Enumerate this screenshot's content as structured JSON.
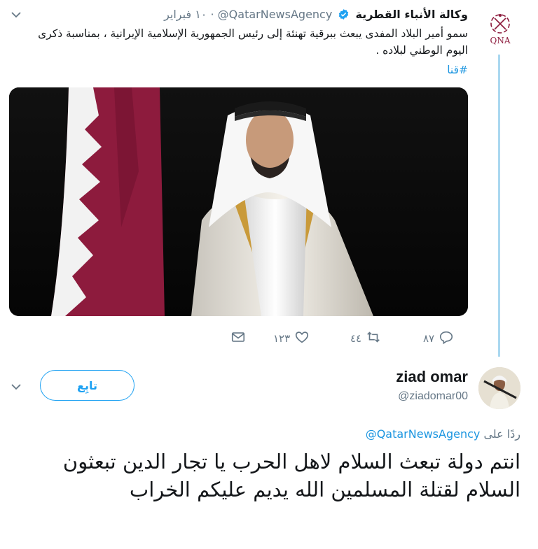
{
  "parent": {
    "author_name": "وكالة الأنباء القطرية",
    "handle": "@QatarNewsAgency",
    "separator": "·",
    "timestamp": "١٠ فبراير",
    "text": "سمو أمير البلاد المفدى يبعث ببرقية تهنئة إلى رئيس الجمهورية الإسلامية الإيرانية ، بمناسبة ذكرى اليوم الوطني لبلاده .",
    "hashtag": "#قنا",
    "avatar_label": "QNA",
    "actions": {
      "replies": "٨٧",
      "retweets": "٤٤",
      "likes": "١٢٣"
    }
  },
  "reply": {
    "author_name": "ziad omar",
    "handle": "@ziadomar00",
    "follow_label": "تابِع",
    "replying_prefix": "ردًا على",
    "replying_to": "@QatarNewsAgency",
    "text": "انتم دولة تبعث السلام لاهل الحرب يا تجار الدين تبعثون السلام لقتلة المسلمين الله يديم عليكم الخراب"
  },
  "colors": {
    "accent": "#1da1f2",
    "link": "#1b95e0",
    "muted": "#657786",
    "thread_line": "#aad8f0",
    "flag_maroon": "#8d1b3d"
  },
  "icons": {
    "caret": "chevron-down-icon",
    "verified": "verified-badge-icon",
    "reply": "reply-icon",
    "retweet": "retweet-icon",
    "like": "heart-icon",
    "dm": "envelope-icon"
  }
}
